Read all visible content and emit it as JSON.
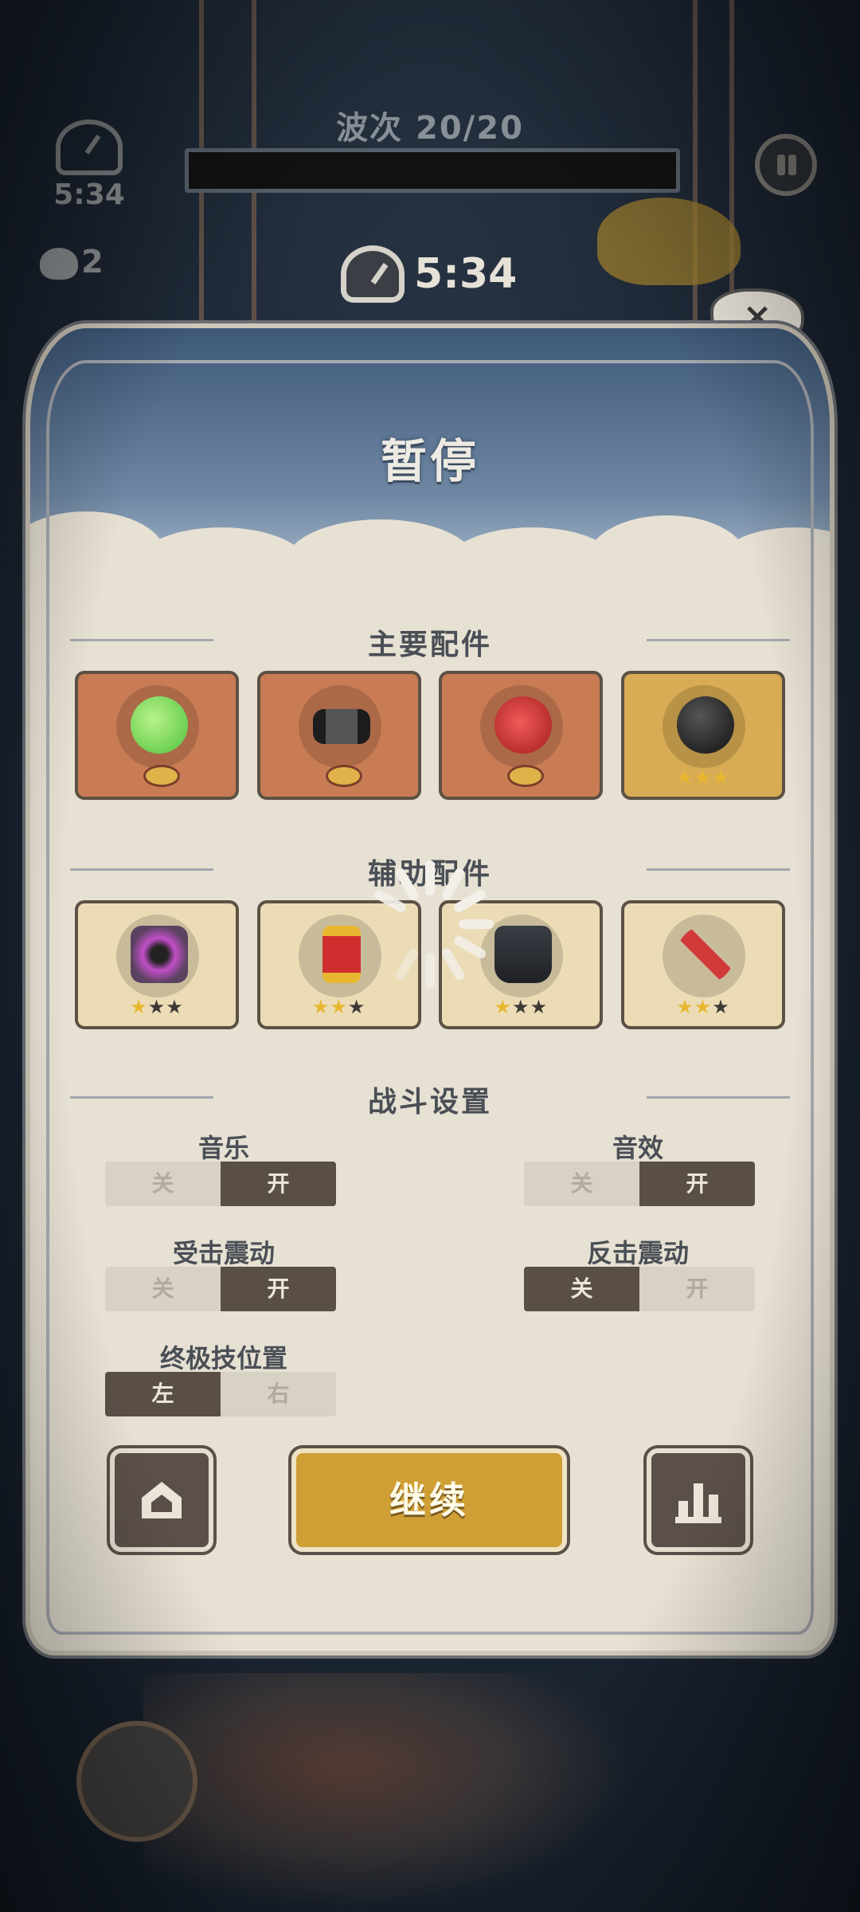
{
  "hud": {
    "wave_label": "波次 20/20",
    "timer_small": "5:34",
    "timer_main": "5:34",
    "kill_count": "2",
    "close_symbol": "×"
  },
  "panel": {
    "title": "暂停",
    "main_parts_title": "主要配件",
    "aux_parts_title": "辅助配件",
    "battle_settings_title": "战斗设置",
    "main_parts": [
      {
        "icon": "green-slime-orb-icon",
        "rarity": "badge"
      },
      {
        "icon": "dumbbell-icon",
        "rarity": "badge"
      },
      {
        "icon": "red-molecule-icon",
        "rarity": "badge"
      },
      {
        "icon": "black-bomb-icon",
        "stars": 3
      }
    ],
    "aux_parts": [
      {
        "icon": "purple-vortex-icon",
        "stars": 1
      },
      {
        "icon": "red-scroll-icon",
        "stars": 2
      },
      {
        "icon": "armor-vest-icon",
        "stars": 1
      },
      {
        "icon": "syringe-icon",
        "stars": 2
      }
    ],
    "settings": {
      "music": {
        "label": "音乐",
        "off": "关",
        "on": "开",
        "value": "开"
      },
      "sfx": {
        "label": "音效",
        "off": "关",
        "on": "开",
        "value": "开"
      },
      "hit_vibration": {
        "label": "受击震动",
        "off": "关",
        "on": "开",
        "value": "开"
      },
      "counter_vibration": {
        "label": "反击震动",
        "off": "关",
        "on": "开",
        "value": "关"
      },
      "ultimate_position": {
        "label": "终极技位置",
        "left": "左",
        "right": "右",
        "value": "左"
      }
    },
    "continue_label": "继续"
  },
  "colors": {
    "panel_bg": "#e7e1d3",
    "toggle_on": "#5a4f47",
    "continue_button": "#cf9f36",
    "main_slot": "#c97c54",
    "gold_slot": "#d8ac54"
  }
}
